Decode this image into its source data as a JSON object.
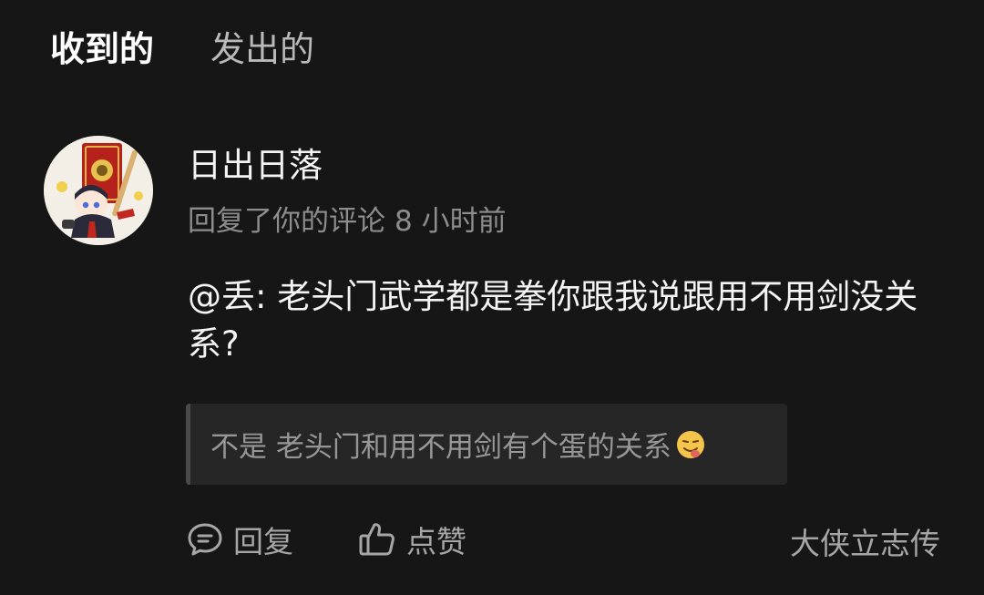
{
  "tabs": {
    "received": "收到的",
    "sent": "发出的"
  },
  "notification": {
    "username": "日出日落",
    "action_text": "回复了你的评论",
    "time_ago": "8 小时前",
    "comment": "@丢: 老头门武学都是拳你跟我说跟用不用剑没关系?",
    "quoted": "不是 老头门和用不用剑有个蛋的关系",
    "quoted_emoji": "smug-face-emoji"
  },
  "actions": {
    "reply_label": "回复",
    "like_label": "点赞",
    "title_badge": "大侠立志传"
  },
  "icons": [
    "chat-bubble-icon",
    "thumbs-up-icon"
  ],
  "colors": {
    "background": "#161616",
    "accent": "#2fc2b0",
    "muted_text": "#8d8d8d",
    "quote_bg": "#262626"
  }
}
